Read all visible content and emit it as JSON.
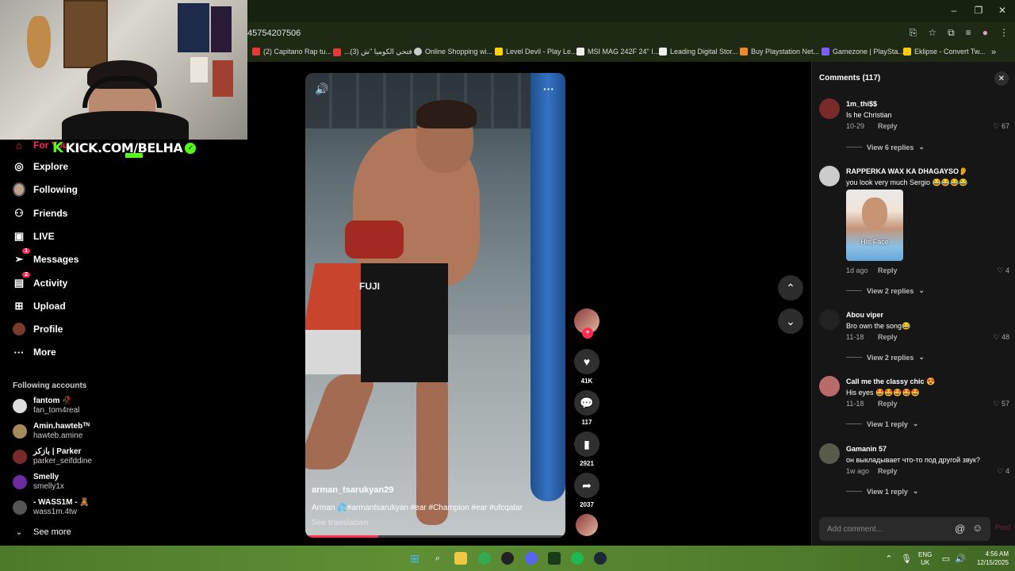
{
  "browser": {
    "url": "45754207506",
    "bookmarks": [
      {
        "label": "(2) Capitano Rap tu...",
        "color": "#e53935"
      },
      {
        "label": "...فتحي الكوميا \"ش (3)",
        "color": "#e53935"
      },
      {
        "label": "Online Shopping wi...",
        "color": "#cccccc"
      },
      {
        "label": "Level Devil - Play Le...",
        "color": "#ffd400"
      },
      {
        "label": "MSI MAG 242F 24\" I...",
        "color": "#eeeeee"
      },
      {
        "label": "Leading Digital Stor...",
        "color": "#eeeeee"
      },
      {
        "label": "Buy Playstation Net...",
        "color": "#f08a24"
      },
      {
        "label": "Gamezone | PlaySta...",
        "color": "#7d5cff"
      },
      {
        "label": "Eklipse - Convert Tw...",
        "color": "#ffcc00"
      }
    ],
    "bookmarks_more": "»",
    "window_controls": {
      "minimize": "–",
      "restore": "❐",
      "close": "✕"
    }
  },
  "overlay": {
    "kick_letter": "K",
    "kick_text": "KICK.COM/BELHA",
    "kick_check": "✓"
  },
  "sidebar": {
    "nav": [
      {
        "label": "For You",
        "icon": "home-icon",
        "glyph": "⌂",
        "color": "#fe2c55"
      },
      {
        "label": "Explore",
        "icon": "compass-icon",
        "glyph": "◎"
      },
      {
        "label": "Following",
        "icon": "following-avatar-icon",
        "glyph": "●"
      },
      {
        "label": "Friends",
        "icon": "friends-icon",
        "glyph": "⚇"
      },
      {
        "label": "LIVE",
        "icon": "live-icon",
        "glyph": "▣"
      },
      {
        "label": "Messages",
        "icon": "messages-icon",
        "glyph": "➢",
        "badge": "1"
      },
      {
        "label": "Activity",
        "icon": "activity-icon",
        "glyph": "▤",
        "badge": "2"
      },
      {
        "label": "Upload",
        "icon": "upload-icon",
        "glyph": "⊞"
      },
      {
        "label": "Profile",
        "icon": "profile-avatar-icon",
        "glyph": "●"
      },
      {
        "label": "More",
        "icon": "more-dots-icon",
        "glyph": "···"
      }
    ],
    "following_title": "Following accounts",
    "accounts": [
      {
        "name": "fantom 🥀",
        "handle": "fan_tom4real",
        "color": "#dddddd"
      },
      {
        "name": "Amin.hawtebᵀᴺ",
        "handle": "hawteb.amine",
        "color": "#a88b5a"
      },
      {
        "name": "بازكر | Parker",
        "handle": "parker_seifddine",
        "color": "#7a2a2a"
      },
      {
        "name": "Smelly",
        "handle": "smelly1x",
        "color": "#6a2ca0"
      },
      {
        "name": "- WASS1M - 🧸",
        "handle": "wass1m.4tw",
        "color": "#555555"
      }
    ],
    "see_more": "See more"
  },
  "video": {
    "author": "arman_tsarukyan29",
    "caption": "Arman 💦#armantsarukyan #ear #Champion #ear #ufcqatar",
    "see_translation": "See translation",
    "shorts_brand": "FUJI",
    "progress": 0.28
  },
  "actions": {
    "likes": "41K",
    "comments": "117",
    "saves": "2921",
    "shares": "2037"
  },
  "comments_panel": {
    "title": "Comments (117)",
    "input_placeholder": "Add comment...",
    "post_label": "Post",
    "items": [
      {
        "user": "1m_thi$$",
        "text": "Is he Christian",
        "date": "10-29",
        "reply": "Reply",
        "likes": "67",
        "view": "View 6 replies",
        "color": "#7a2a2a"
      },
      {
        "user": "RAPPERKA WAX KA DHAGAYSO👂",
        "text": "you look very much Sergio 😂😂😂😂",
        "date": "1d ago",
        "reply": "Reply",
        "likes": "4",
        "view": "View 2 replies",
        "image_caption": "His Face",
        "color": "#cccccc"
      },
      {
        "user": "Abou viper",
        "text": "Bro own the song😂",
        "date": "11-18",
        "reply": "Reply",
        "likes": "48",
        "view": "View 2 replies",
        "color": "#222222"
      },
      {
        "user": "Call me the classy chic 😍",
        "text": "His eyes 🤩🤩🤩🤩🤩",
        "date": "11-18",
        "reply": "Reply",
        "likes": "57",
        "view": "View 1 reply",
        "color": "#b96a6a"
      },
      {
        "user": "Gamanin 57",
        "text": "он выкладывает что-то под другой звук?",
        "date": "1w ago",
        "reply": "Reply",
        "likes": "4",
        "view": "View 1 reply",
        "color": "#5a5a4a"
      }
    ]
  },
  "taskbar": {
    "lang": "ENG",
    "region": "UK",
    "time": "4:56 AM",
    "date": "12/15/2025"
  },
  "colors": {
    "accent": "#fe2c55",
    "kick_green": "#53fc18"
  }
}
